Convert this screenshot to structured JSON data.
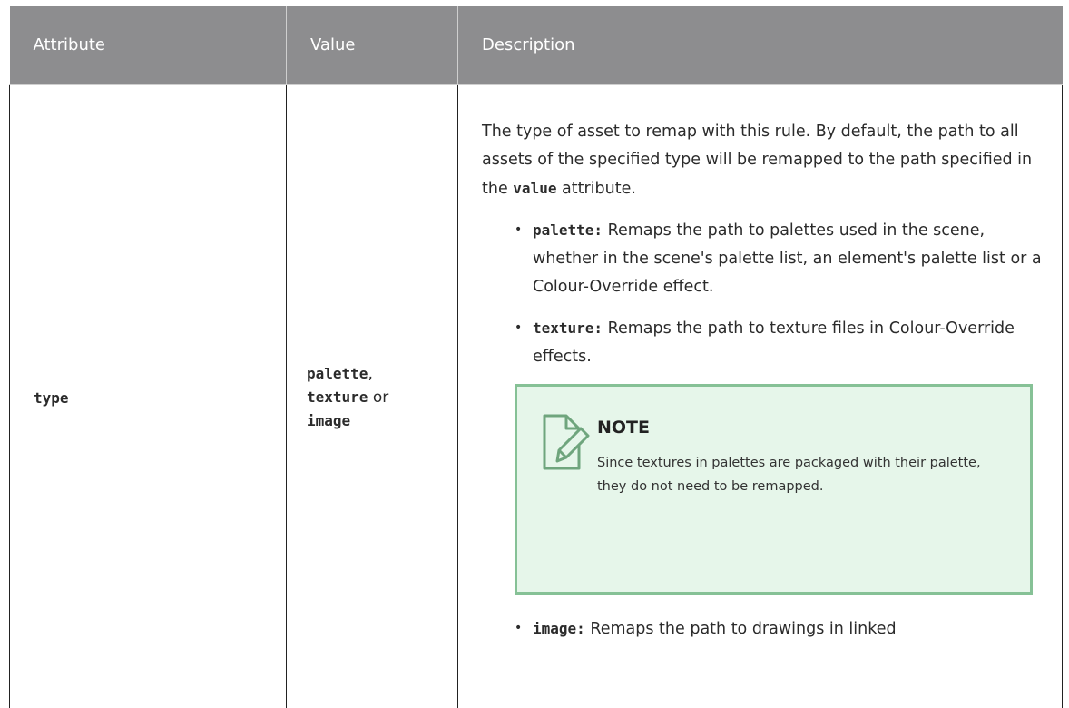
{
  "table": {
    "headers": [
      "Attribute",
      "Value",
      "Description"
    ],
    "row": {
      "attribute": "type",
      "value": {
        "opt1": "palette",
        "sep1": ",",
        "opt2": "texture",
        "sep2": " or",
        "opt3": "image"
      },
      "description": {
        "intro_before": "The type of asset to remap with this rule. By default, the path to all assets of the specified type will be remapped to the path specified in the ",
        "intro_code": "value",
        "intro_after": " attribute.",
        "options": [
          {
            "bullet": "•",
            "code": "palette:",
            "text": " Remaps the path to palettes used in the scene, whether in the scene's palette list, an element's palette list or a Colour-Override effect."
          },
          {
            "bullet": "•",
            "code": "texture:",
            "text": " Remaps the path to texture files in Colour-Override effects."
          },
          {
            "bullet": "•",
            "code": "image:",
            "text": " Remaps the path to drawings in linked"
          }
        ],
        "note": {
          "icon": "note-pencil-icon",
          "title": "NOTE",
          "text": "Since textures in palettes are packaged with their palette, they do not need to be remapped."
        }
      }
    }
  },
  "colors": {
    "header_bg": "#8d8d8f",
    "note_bg": "#e6f6ea",
    "note_border": "#86c196",
    "icon_stroke": "#6fa57d"
  }
}
